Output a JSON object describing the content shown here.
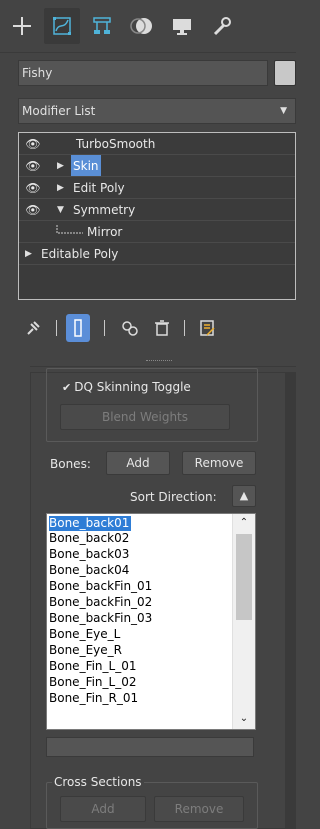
{
  "tabs": [
    {
      "name": "create-tab",
      "icon": "plus-icon"
    },
    {
      "name": "modify-tab",
      "icon": "modify-curve-icon",
      "active": true
    },
    {
      "name": "hierarchy-tab",
      "icon": "hierarchy-icon"
    },
    {
      "name": "motion-tab",
      "icon": "motion-circle-icon"
    },
    {
      "name": "display-tab",
      "icon": "monitor-icon"
    },
    {
      "name": "utilities-tab",
      "icon": "wrench-icon"
    }
  ],
  "object": {
    "name": "Fishy",
    "color": "#c8c8c8"
  },
  "modifier_list": {
    "label": "Modifier List"
  },
  "stack": [
    {
      "label": "TurboSmooth",
      "eye": true,
      "arrow": "",
      "indent": 0
    },
    {
      "label": "Skin",
      "eye": true,
      "arrow": "▶",
      "indent": 0,
      "selected": true
    },
    {
      "label": "Edit Poly",
      "eye": true,
      "arrow": "▶",
      "indent": 0
    },
    {
      "label": "Symmetry",
      "eye": true,
      "arrow": "▼",
      "indent": 0
    },
    {
      "label": "Mirror",
      "eye": false,
      "arrow": "",
      "indent": 1
    },
    {
      "label": "Editable Poly",
      "eye": false,
      "arrow": "▶",
      "indent": -1
    }
  ],
  "toolbar": {
    "pin_icon": "pin-icon",
    "show_end_result_icon": "show-end-result-icon",
    "make_unique_icon": "make-unique-icon",
    "remove_modifier_icon": "trash-icon",
    "configure_icon": "configure-sets-icon"
  },
  "skin": {
    "dq_toggle_label": "DQ Skinning Toggle",
    "blend_weights_label": "Blend Weights",
    "bones_label": "Bones:",
    "add_label": "Add",
    "remove_label": "Remove",
    "sort_direction_label": "Sort Direction:",
    "bones": [
      "Bone_back01",
      "Bone_back02",
      "Bone_back03",
      "Bone_back04",
      "Bone_backFin_01",
      "Bone_backFin_02",
      "Bone_backFin_03",
      "Bone_Eye_L",
      "Bone_Eye_R",
      "Bone_Fin_L_01",
      "Bone_Fin_L_02",
      "Bone_Fin_R_01"
    ],
    "selected_bone": "Bone_back01",
    "cross_sections_label": "Cross Sections",
    "cs_add_label": "Add",
    "cs_remove_label": "Remove"
  },
  "colors": {
    "selection": "#5a8fd6",
    "list_selection": "#2e7dd6",
    "background": "#444444"
  }
}
